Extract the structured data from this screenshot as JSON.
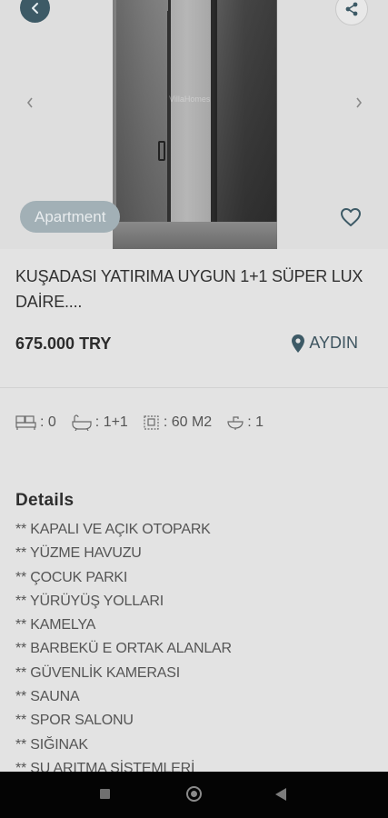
{
  "listing": {
    "type_badge": "Apartment",
    "title": "KUŞADASI YATIRIMA UYGUN 1+1 SÜPER LUX DAİRE....",
    "price": "675.000 TRY",
    "location": "AYDIN",
    "photo_watermark": "VillaHomes"
  },
  "specs": [
    {
      "icon": "bed-icon",
      "value": ": 0"
    },
    {
      "icon": "bath-icon",
      "value": ": 1+1"
    },
    {
      "icon": "area-icon",
      "value": ": 60 M2"
    },
    {
      "icon": "sink-icon",
      "value": ": 1"
    }
  ],
  "details": {
    "heading": "Details",
    "items": [
      "** KAPALI VE AÇIK OTOPARK",
      "** YÜZME HAVUZU",
      "** ÇOCUK PARKI",
      "** YÜRÜYÜŞ YOLLARI",
      "** KAMELYA",
      "** BARBEKÜ E ORTAK ALANLAR",
      "** GÜVENLİK KAMERASI",
      "** SAUNA",
      "** SPOR SALONU",
      "** SIĞINAK",
      "** SU ARITMA SİSTEMLERİ"
    ]
  },
  "colors": {
    "accent": "#3d5a66",
    "badge_bg": "#a2b0b6",
    "background": "#e3e3e3",
    "system_nav": "#040404"
  },
  "icons": {
    "back": "arrow-left-icon",
    "share": "share-icon",
    "prev": "chevron-left-icon",
    "next": "chevron-right-icon",
    "favorite": "heart-icon",
    "location": "map-pin-icon"
  }
}
